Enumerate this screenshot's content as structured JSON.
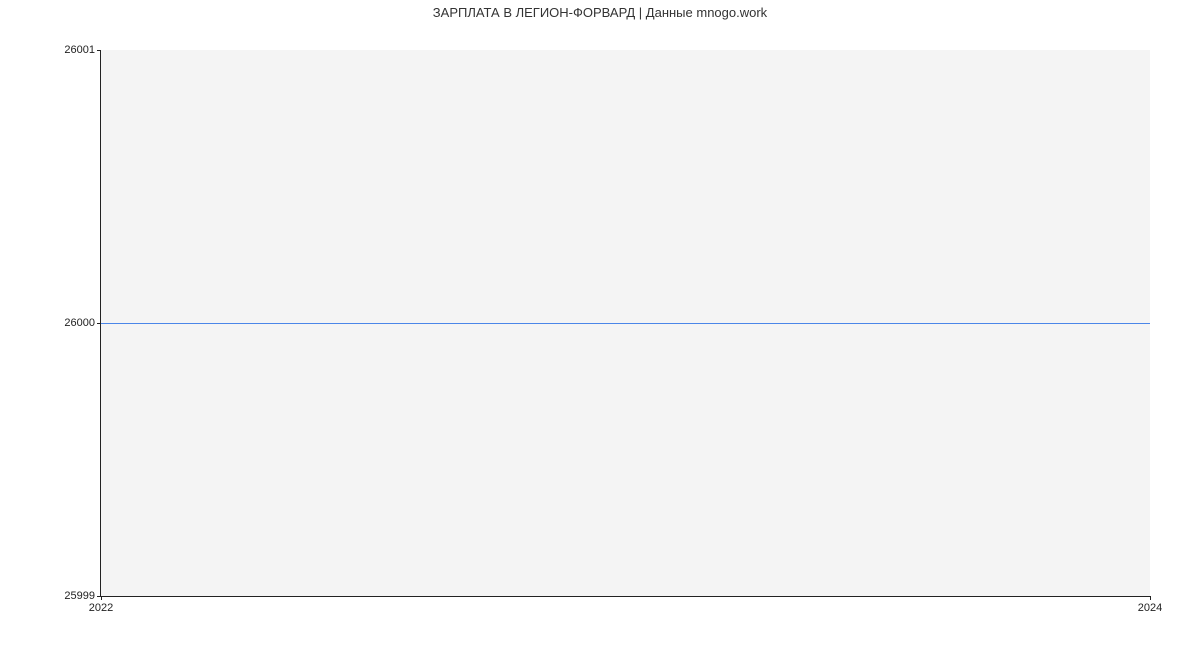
{
  "chart_data": {
    "type": "line",
    "title": "ЗАРПЛАТА В ЛЕГИОН-ФОРВАРД | Данные mnogo.work",
    "xlabel": "",
    "ylabel": "",
    "x": [
      2022,
      2024
    ],
    "y": [
      26000,
      26000
    ],
    "ylim": [
      25999,
      26001
    ],
    "xlim": [
      2022,
      2024
    ],
    "y_ticks": [
      25999,
      26000,
      26001
    ],
    "x_ticks": [
      2022,
      2024
    ],
    "line_color": "#4a86e8"
  }
}
